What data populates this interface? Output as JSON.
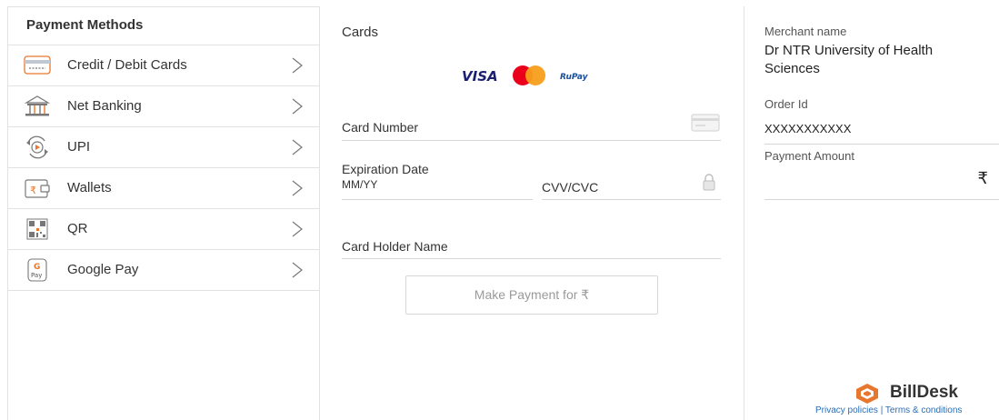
{
  "sidebar": {
    "title": "Payment Methods",
    "items": [
      {
        "label": "Credit / Debit Cards",
        "icon": "credit-card-icon"
      },
      {
        "label": "Net Banking",
        "icon": "bank-icon"
      },
      {
        "label": "UPI",
        "icon": "upi-icon"
      },
      {
        "label": "Wallets",
        "icon": "wallet-icon"
      },
      {
        "label": "QR",
        "icon": "qr-code-icon"
      },
      {
        "label": "Google Pay",
        "icon": "google-pay-icon"
      }
    ]
  },
  "cards": {
    "title": "Cards",
    "logos": [
      "VISA",
      "RuPay"
    ],
    "card_number_label": "Card Number",
    "expiration_label": "Expiration Date",
    "expiration_placeholder": "MM/YY",
    "cvv_label": "CVV/CVC",
    "holder_label": "Card Holder Name",
    "pay_button": "Make Payment for ₹"
  },
  "merchant": {
    "name_label": "Merchant name",
    "name_value": "Dr NTR University of Health Sciences",
    "name_line1": "Dr NTR University of Health",
    "name_line2": "Sciences",
    "order_label": "Order Id",
    "order_value": "XXXXXXXXXXX",
    "amount_label": "Payment Amount",
    "currency_symbol": "₹"
  },
  "footer": {
    "brand": "BillDesk",
    "privacy_link": "Privacy policies",
    "separator": "|",
    "terms_link": "Terms & conditions"
  },
  "colors": {
    "brand_orange": "#e8772e",
    "link_blue": "#2a6db5",
    "visa_blue": "#1a1f71"
  }
}
